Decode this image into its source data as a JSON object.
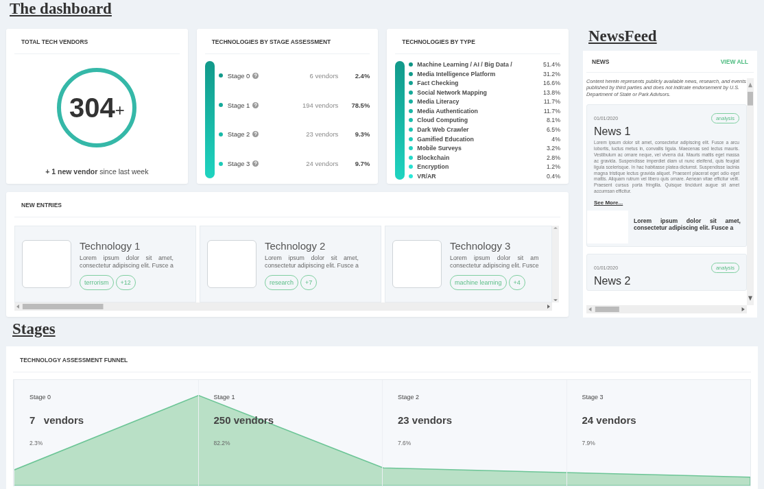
{
  "title": "The dashboard",
  "total_vendors": {
    "title": "TOTAL TECH VENDORS",
    "count": "304",
    "suffix": "+",
    "caption": "**+ 1 new vendor** since last week"
  },
  "stage_assessment": {
    "title": "TECHNOLOGIES BY STAGE ASSESSMENT",
    "items": [
      {
        "name": "Stage 0",
        "vendors": "6 vendors",
        "percent": "2.4%",
        "color": "#12998a"
      },
      {
        "name": "Stage 1",
        "vendors": "194 vendors",
        "percent": "78.5%",
        "color": "#14a999"
      },
      {
        "name": "Stage 2",
        "vendors": "23 vendors",
        "percent": "9.3%",
        "color": "#17b9a7"
      },
      {
        "name": "Stage 3",
        "vendors": "24 vendors",
        "percent": "9.7%",
        "color": "#1dcab7"
      }
    ]
  },
  "technology_types": {
    "title": "TECHNOLOGIES BY TYPE",
    "items": [
      {
        "name": "Machine Learning / AI / Big Data /",
        "percent": "51.4%",
        "color": "#0f9484"
      },
      {
        "name": "Media Intelligence Platform",
        "percent": "31.2%",
        "color": "#119a8a"
      },
      {
        "name": "Fact Checking",
        "percent": "16.6%",
        "color": "#13a191"
      },
      {
        "name": "Social Network Mapping",
        "percent": "13.8%",
        "color": "#15a898"
      },
      {
        "name": "Media Literacy",
        "percent": "11.7%",
        "color": "#17af9f"
      },
      {
        "name": "Media Authentication",
        "percent": "11.7%",
        "color": "#19b6a6"
      },
      {
        "name": "Cloud Computing",
        "percent": "8.1%",
        "color": "#1bbdad"
      },
      {
        "name": "Dark Web Crawler",
        "percent": "6.5%",
        "color": "#1dc4b4"
      },
      {
        "name": "Gamified Education",
        "percent": "4%",
        "color": "#1fcbbb"
      },
      {
        "name": "Mobile Surveys",
        "percent": "3.2%",
        "color": "#21d2c2"
      },
      {
        "name": "Blockchain",
        "percent": "2.8%",
        "color": "#24d9c9"
      },
      {
        "name": "Encryption",
        "percent": "1.2%",
        "color": "#27e0d0"
      },
      {
        "name": "VR/AR",
        "percent": "0.4%",
        "color": "#2ae7d7"
      }
    ]
  },
  "new_entries": {
    "title": "NEW ENTRIES",
    "items": [
      {
        "title": "Technology  1",
        "description": "Lorem ipsum dolor sit amet,\nconsectetur adipiscing elit. Fusce a",
        "tags": [
          "terrorism",
          "+12"
        ]
      },
      {
        "title": "Technology  2",
        "description": "Lorem ipsum dolor sit amet,\nconsectetur adipiscing elit. Fusce a",
        "tags": [
          "research",
          "+7"
        ]
      },
      {
        "title": "Technology  3",
        "description": "Lorem ipsum dolor sit am\nconsectetur adipiscing elit. Fusce",
        "tags": [
          "machine learning",
          "+4"
        ]
      }
    ]
  },
  "newsfeed": {
    "heading": "NewsFeed",
    "title": "NEWS",
    "view_all": "VIEW ALL",
    "disclaimer": "Content herein represents publicly available news, research, and events published by third parties and does not indicate endorsement by U.S. Department of State or Park Advisors.",
    "items": [
      {
        "date": "01/01/2020",
        "tag": "analysis",
        "title": "News 1",
        "body": "Lorem ipsum dolor sit amet, consectetur adipiscing elit. Fusce a arcu lobortis, luctus metus in, convallis ligula. Maecenas sed lectus mauris. Vestibulum ac ornare neque, vel viverra dui. Mauris mattis eget massa ac gravida. Suspendisse imperdiet diam ut nunc eleifend, quis feugiat ligula scelerisque. In hac habitasse platea dictumst. Suspendisse lacinia magna tristique lectus gravida aliquet. Praesent placerat eget odio eget mattis. Aliquam rutrum vel libero quis ornare. Aenean vitae efficitur velit. Praesent cursus porta fringilla. Quisque tincidunt augue sit amet accumsan efficitur.",
        "see_more": "See More...",
        "extra": "Lorem ipsum dolor sit amet, consectetur adipiscing elit. Fusce a"
      },
      {
        "date": "01/01/2020",
        "tag": "analysis",
        "title": "News 2"
      }
    ]
  },
  "stages": {
    "heading": "Stages",
    "title": "TECHNOLOGY ASSESSMENT FUNNEL",
    "items": [
      {
        "name": "Stage 0",
        "vendors": "7   vendors",
        "percent": "2.3%"
      },
      {
        "name": "Stage 1",
        "vendors": "250 vendors",
        "percent": "82.2%"
      },
      {
        "name": "Stage 2",
        "vendors": "23 vendors",
        "percent": "7.6%"
      },
      {
        "name": "Stage 3",
        "vendors": "24 vendors",
        "percent": "7.9%"
      }
    ]
  }
}
